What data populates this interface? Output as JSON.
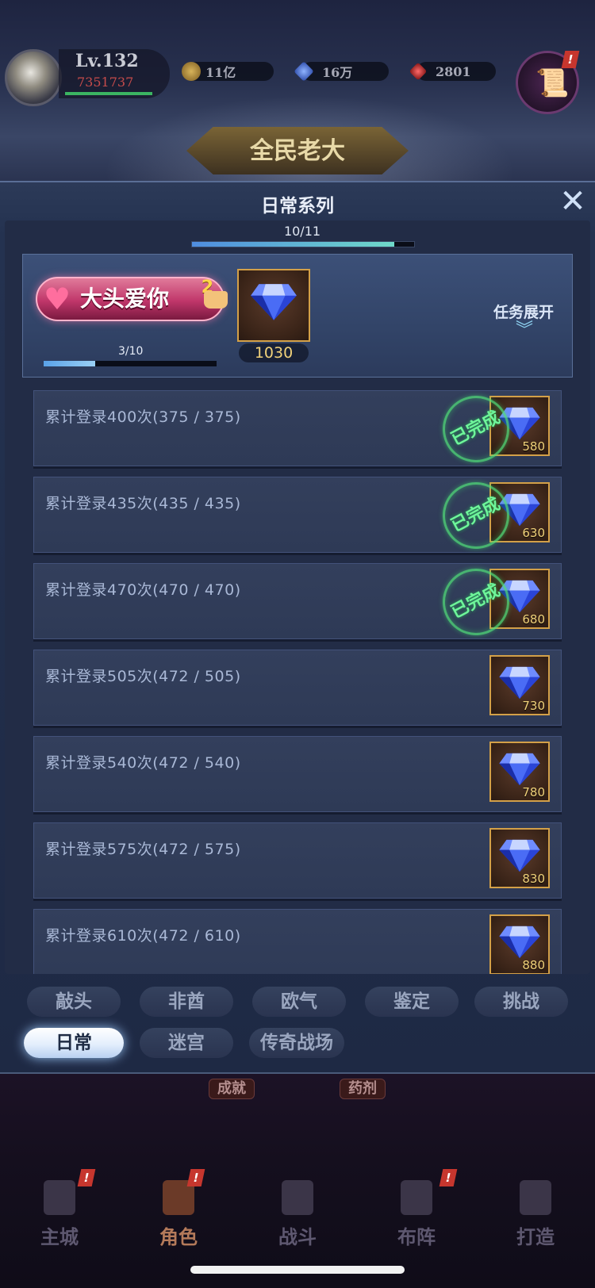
{
  "hud": {
    "level": "Lv.132",
    "power": "7351737",
    "gold": "11亿",
    "gems": "16万",
    "ruby": "2801",
    "banner": "全民老大"
  },
  "panel": {
    "title": "日常系列",
    "close_glyph": "✕",
    "overall_progress": {
      "label": "10/11",
      "fraction": 0.9091
    }
  },
  "featured": {
    "logo_text": "大头爱你",
    "logo_badge": "2",
    "progress": {
      "label": "3/10",
      "fraction": 0.3
    },
    "reward": {
      "icon": "diamond-icon",
      "quantity": "1030"
    },
    "expand_label": "任务展开",
    "expand_glyph": "︾"
  },
  "tasks": [
    {
      "label": "累计登录400次(375 / 375)",
      "reward": "580",
      "completed": true,
      "stamp": "已完成"
    },
    {
      "label": "累计登录435次(435 / 435)",
      "reward": "630",
      "completed": true,
      "stamp": "已完成"
    },
    {
      "label": "累计登录470次(470 / 470)",
      "reward": "680",
      "completed": true,
      "stamp": "已完成"
    },
    {
      "label": "累计登录505次(472 / 505)",
      "reward": "730",
      "completed": false
    },
    {
      "label": "累计登录540次(472 / 540)",
      "reward": "780",
      "completed": false
    },
    {
      "label": "累计登录575次(472 / 575)",
      "reward": "830",
      "completed": false
    },
    {
      "label": "累计登录610次(472 / 610)",
      "reward": "880",
      "completed": false
    }
  ],
  "tabs": {
    "row1": [
      "敲头",
      "非酋",
      "欧气",
      "鉴定",
      "挑战"
    ],
    "row2": [
      "日常",
      "迷宫",
      "传奇战场"
    ],
    "active": "日常"
  },
  "background": {
    "tags": [
      "成就",
      "药剂"
    ],
    "nav": [
      "主城",
      "角色",
      "战斗",
      "布阵",
      "打造"
    ],
    "nav_active": "角色"
  },
  "colors": {
    "accent_gold": "#d3a048",
    "stamp_green": "#6ef59a",
    "tab_active": "#e3eefc"
  }
}
